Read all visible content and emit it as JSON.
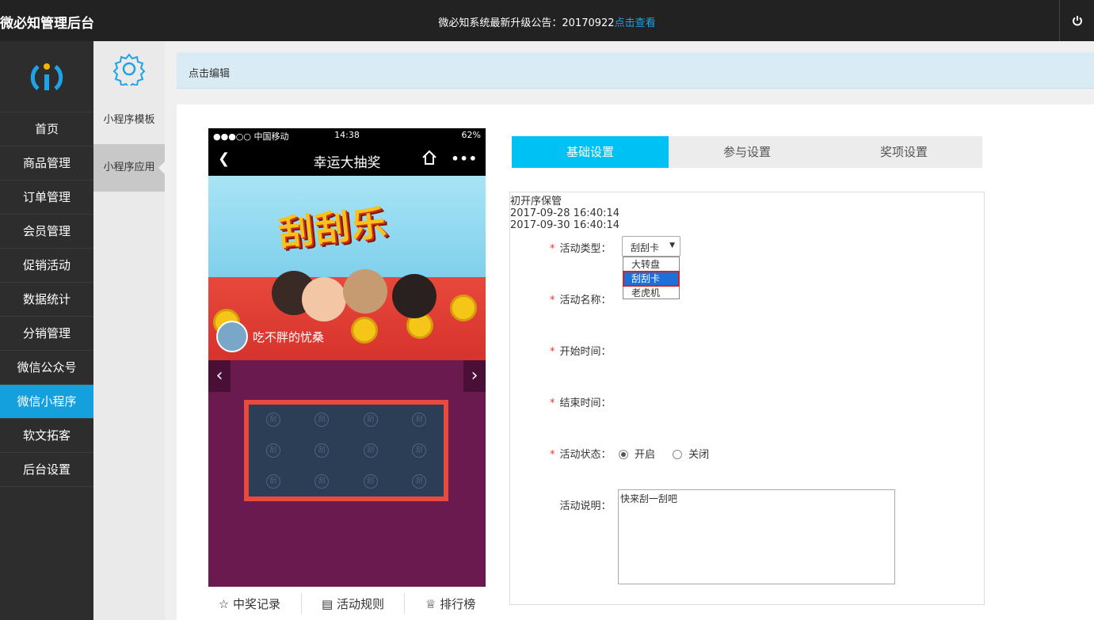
{
  "topbar": {
    "brand": "微必知管理后台",
    "notice": "微必知系统最新升级公告：20170922",
    "notice_link": "点击查看"
  },
  "nav": {
    "items": [
      "首页",
      "商品管理",
      "订单管理",
      "会员管理",
      "促销活动",
      "数据统计",
      "分销管理",
      "微信公众号",
      "微信小程序",
      "软文拓客",
      "后台设置"
    ],
    "active": "微信小程序"
  },
  "subnav": {
    "items": [
      "小程序模板",
      "小程序应用"
    ],
    "active": "小程序应用"
  },
  "editbar": {
    "label": "点击编辑"
  },
  "phone": {
    "status_left": "●●●○○ 中国移动",
    "status_time": "14:38",
    "status_right": "62%",
    "title": "幸运大抽奖",
    "banner_text": "刮刮乐",
    "user_name": "吃不胖的忧桑",
    "card_glyph": "刮",
    "bottom": [
      "中奖记录",
      "活动规则",
      "排行榜"
    ]
  },
  "tabs": [
    "基础设置",
    "参与设置",
    "奖项设置"
  ],
  "form": {
    "type_label": "活动类型：",
    "type_value": "刮刮卡",
    "type_options": [
      "大转盘",
      "刮刮卡",
      "老虎机"
    ],
    "name_label": "活动名称：",
    "name_value": "初开序保管",
    "start_label": "开始时间：",
    "start_value": "2017-09-28 16:40:14",
    "end_label": "结束时间：",
    "end_value": "2017-09-30 16:40:14",
    "status_label": "活动状态：",
    "status_on": "开启",
    "status_off": "关闭",
    "desc_label": "活动说明：",
    "desc_value": "快来刮一刮吧"
  },
  "colors": {
    "accent": "#14a0dc",
    "tab_active": "#00c1f3",
    "required": "#ee3333"
  }
}
